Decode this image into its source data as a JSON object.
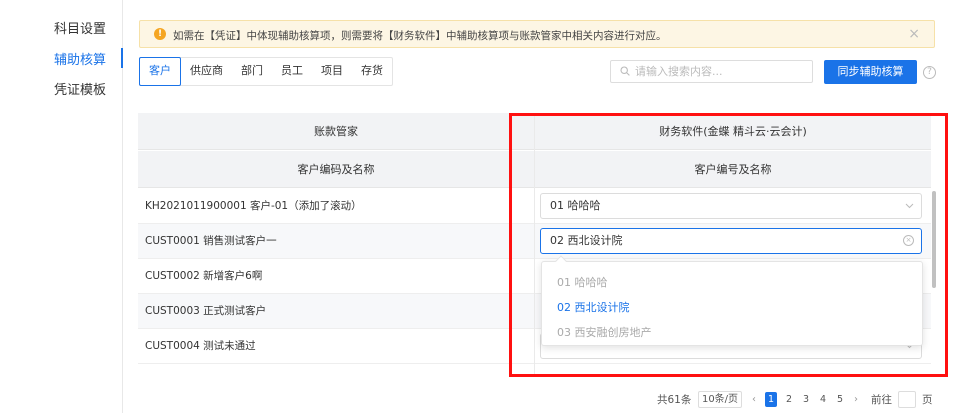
{
  "sidebar": {
    "items": [
      {
        "label": "科目设置"
      },
      {
        "label": "辅助核算"
      },
      {
        "label": "凭证模板"
      }
    ]
  },
  "alert": {
    "text": "如需在【凭证】中体现辅助核算项，则需要将【财务软件】中辅助核算项与账款管家中相关内容进行对应。",
    "icon": "warning-icon",
    "color": "#f5a623"
  },
  "tabs": [
    {
      "label": "客户"
    },
    {
      "label": "供应商"
    },
    {
      "label": "部门"
    },
    {
      "label": "员工"
    },
    {
      "label": "项目"
    },
    {
      "label": "存货"
    }
  ],
  "search": {
    "placeholder": "请输入搜索内容..."
  },
  "sync_button": "同步辅助核算",
  "table": {
    "left_group": "账款管家",
    "right_group": "财务软件(金蝶 精斗云·云会计)",
    "left_col": "客户编码及名称",
    "right_col": "客户编号及名称",
    "rows": [
      {
        "left": "KH2021011900001 客户-01（添加了滚动）",
        "right": "01 哈哈哈"
      },
      {
        "left": "CUST0001 销售测试客户一",
        "right": "02 西北设计院"
      },
      {
        "left": "CUST0002 新增客户6啊",
        "right": ""
      },
      {
        "left": "CUST0003 正式测试客户",
        "right": ""
      },
      {
        "left": "CUST0004 测试未通过",
        "right": ""
      }
    ]
  },
  "dropdown": {
    "options": [
      {
        "label": "01  哈哈哈"
      },
      {
        "label": "02  西北设计院"
      },
      {
        "label": "03  西安融创房地产"
      }
    ]
  },
  "pagination": {
    "total": "共61条",
    "page_size": "10条/页",
    "pages": [
      "1",
      "2",
      "3",
      "4",
      "5"
    ],
    "current": "1",
    "goto_label": "前往",
    "page_unit": "页"
  },
  "colors": {
    "accent": "#1a73e8",
    "highlight": "#ff1010"
  }
}
